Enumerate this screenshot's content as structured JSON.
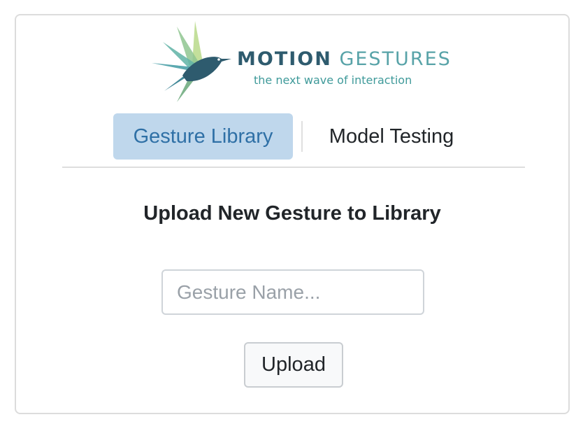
{
  "logo": {
    "title_part1": "MOTION",
    "title_part2": "GESTURES",
    "tagline": "the next wave of interaction",
    "icon": "hummingbird-logo-icon",
    "colors": {
      "dark_teal": "#2e5b6e",
      "teal": "#58a3a8",
      "green": "#7fb77e"
    }
  },
  "nav": {
    "tabs": [
      {
        "label": "Gesture Library",
        "active": true
      },
      {
        "label": "Model Testing",
        "active": false
      }
    ],
    "active_bg": "#bfd7ec",
    "active_color": "#2f70a6"
  },
  "upload_form": {
    "heading": "Upload New Gesture to Library",
    "name_placeholder": "Gesture Name...",
    "name_value": "",
    "submit_label": "Upload"
  }
}
